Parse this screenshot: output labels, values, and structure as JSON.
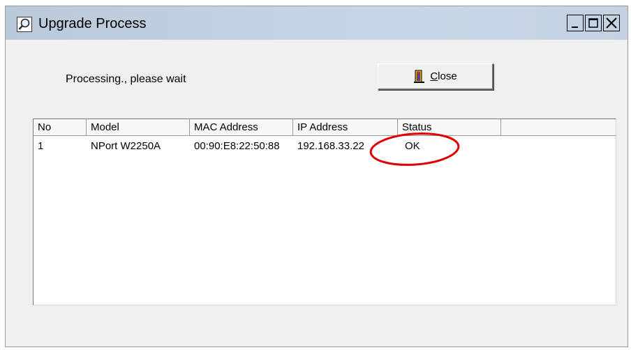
{
  "window": {
    "title": "Upgrade Process",
    "controls": {
      "minimize": "_",
      "maximize": "□",
      "close": "X"
    }
  },
  "main": {
    "status_text": "Processing., please wait",
    "close_button": {
      "mnemonic": "C",
      "rest": "lose"
    }
  },
  "table": {
    "columns": [
      "No",
      "Model",
      "MAC Address",
      "IP Address",
      "Status",
      ""
    ],
    "rows": [
      {
        "no": "1",
        "model": "NPort W2250A",
        "mac": "00:90:E8:22:50:88",
        "ip": "192.168.33.22",
        "status": "OK"
      }
    ]
  },
  "colors": {
    "title_gradient_start": "#b9c9da",
    "title_gradient_end": "#c8d7e7",
    "annotation_circle": "#e00000"
  },
  "icons": {
    "title": "magnifier-icon",
    "close_button": "door-exit-icon"
  }
}
